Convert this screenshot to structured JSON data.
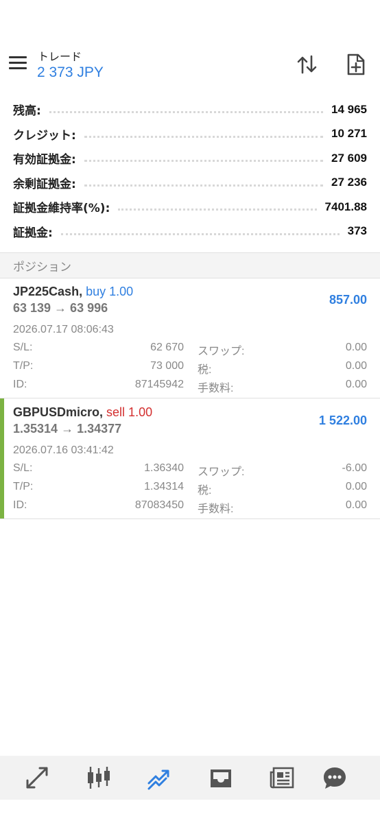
{
  "header": {
    "title": "トレード",
    "subtitle": "2 373 JPY",
    "sort_icon": "sort-arrows-icon",
    "new_order_icon": "new-document-icon"
  },
  "summary": [
    {
      "label": "残高:",
      "value": "14 965"
    },
    {
      "label": "クレジット:",
      "value": "10 271"
    },
    {
      "label": "有効証拠金:",
      "value": "27 609"
    },
    {
      "label": "余剰証拠金:",
      "value": "27 236"
    },
    {
      "label": "証拠金維持率(%):",
      "value": "7401.88"
    },
    {
      "label": "証拠金:",
      "value": "373"
    }
  ],
  "positions_header": "ポジション",
  "positions": [
    {
      "symbol": "JP225Cash,",
      "side": "buy 1.00",
      "prices": "63 139 → 63 996",
      "profit": "857.00",
      "time": "2026.07.17 08:06:43",
      "sl_label": "S/L:",
      "sl": "62 670",
      "tp_label": "T/P:",
      "tp": "73 000",
      "id_label": "ID:",
      "id": "87145942",
      "swap_label": "スワップ:",
      "swap": "0.00",
      "tax_label": "税:",
      "tax": "0.00",
      "fee_label": "手数料:",
      "fee": "0.00"
    },
    {
      "symbol": "GBPUSDmicro,",
      "side": "sell 1.00",
      "prices": "1.35314 → 1.34377",
      "profit": "1 522.00",
      "time": "2026.07.16 03:41:42",
      "sl_label": "S/L:",
      "sl": "1.36340",
      "tp_label": "T/P:",
      "tp": "1.34314",
      "id_label": "ID:",
      "id": "87083450",
      "swap_label": "スワップ:",
      "swap": "-6.00",
      "tax_label": "税:",
      "tax": "0.00",
      "fee_label": "手数料:",
      "fee": "0.00"
    }
  ],
  "colors": {
    "accent_blue": "#2f7fe0",
    "sell_red": "#d32f2f",
    "selected_green": "#7cb342"
  },
  "bottom_nav": [
    "quotes-icon",
    "chart-icon",
    "trade-icon",
    "inbox-icon",
    "news-icon",
    "chat-icon"
  ]
}
